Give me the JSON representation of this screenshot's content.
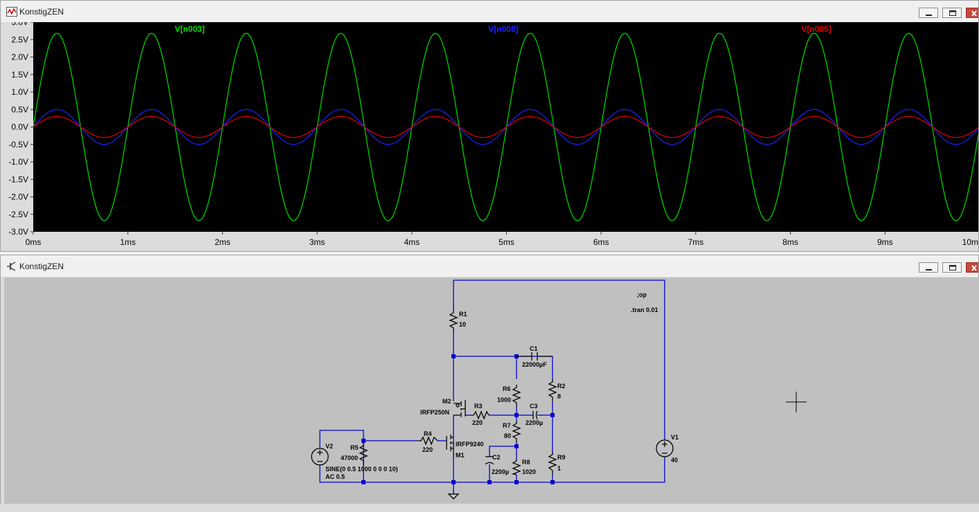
{
  "plot_window": {
    "title": "KonstigZEN",
    "icon": "waveform-icon",
    "controls": [
      "minimize-icon",
      "maximize-icon",
      "close-icon"
    ]
  },
  "schematic_window": {
    "title": "KonstigZEN",
    "icon": "transistor-icon",
    "controls": [
      "minimize-icon",
      "maximize-icon",
      "close-icon"
    ]
  },
  "chart_data": {
    "type": "line",
    "background": "#000000",
    "grid": false,
    "legend_position": "top",
    "xlabel": "",
    "ylabel": "",
    "xlim": [
      0,
      10
    ],
    "ylim": [
      -3.0,
      3.0
    ],
    "x_unit": "ms",
    "x_ticks": [
      "0ms",
      "1ms",
      "2ms",
      "3ms",
      "4ms",
      "5ms",
      "6ms",
      "7ms",
      "8ms",
      "9ms",
      "10m"
    ],
    "y_ticks": [
      "3.0V",
      "2.5V",
      "2.0V",
      "1.5V",
      "1.0V",
      "0.5V",
      "0.0V",
      "-0.5V",
      "-1.0V",
      "-1.5V",
      "-2.0V",
      "-2.5V",
      "-3.0V"
    ],
    "series": [
      {
        "name": "V[n003]",
        "color": "#00e000",
        "waveform": "sine",
        "amplitude": 2.68,
        "frequency_khz": 1.0,
        "phase_deg": 0
      },
      {
        "name": "V[n008]",
        "color": "#2020ff",
        "waveform": "sine",
        "amplitude": 0.5,
        "frequency_khz": 1.0,
        "phase_deg": 0
      },
      {
        "name": "V[n005]",
        "color": "#e00000",
        "waveform": "sine",
        "amplitude": 0.3,
        "frequency_khz": 1.0,
        "phase_deg": 0
      }
    ]
  },
  "schematic": {
    "wire_color": "#0000cc",
    "components": [
      {
        "ref": "R1",
        "value": "10"
      },
      {
        "ref": "C1",
        "value": "22000µF"
      },
      {
        "ref": "R2",
        "value": "8"
      },
      {
        "ref": "R6",
        "value": "1000"
      },
      {
        "ref": "C3",
        "value": "2200µ"
      },
      {
        "ref": "R3",
        "value": "220"
      },
      {
        "ref": "M2",
        "value": "IRFP250N"
      },
      {
        "ref": "R7",
        "value": "80"
      },
      {
        "ref": "R4",
        "value": "220"
      },
      {
        "ref": "M1",
        "value": "IRFP9240"
      },
      {
        "ref": "R5",
        "value": "47000"
      },
      {
        "ref": "V2",
        "value": ""
      },
      {
        "ref": "C2",
        "value": "2200µ"
      },
      {
        "ref": "R8",
        "value": "1020"
      },
      {
        "ref": "R9",
        "value": "1"
      },
      {
        "ref": "V1",
        "value": "40"
      }
    ],
    "source_spec": [
      "SINE(0 0.5 1000 0 0 0 10)",
      "AC 0.5"
    ],
    "directives": [
      ";op",
      ".tran 0.01"
    ],
    "cursor": "crosshair-cursor"
  }
}
